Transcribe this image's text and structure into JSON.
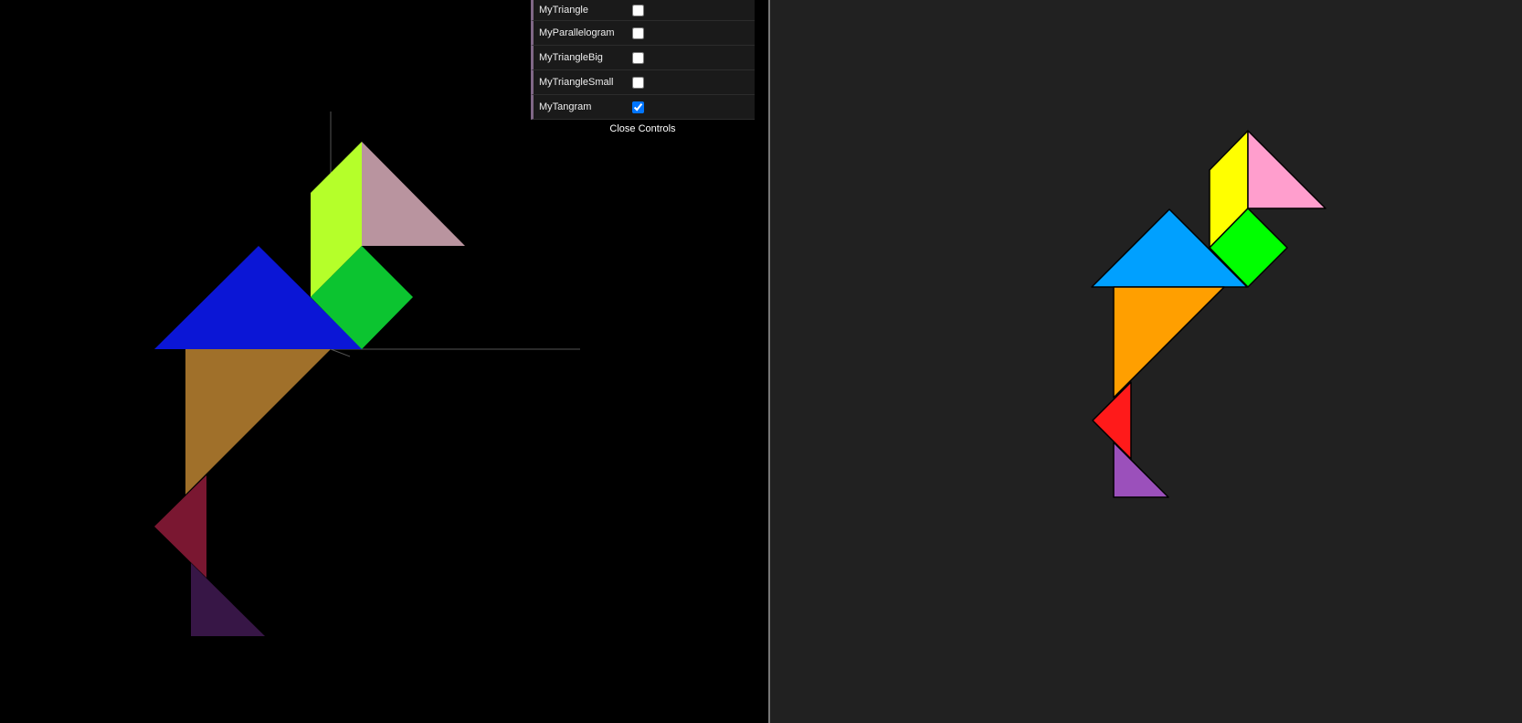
{
  "controls": {
    "items": [
      {
        "label": "MyTriangle",
        "checked": false
      },
      {
        "label": "MyParallelogram",
        "checked": false
      },
      {
        "label": "MyTriangleBig",
        "checked": false
      },
      {
        "label": "MyTriangleSmall",
        "checked": false
      },
      {
        "label": "MyTangram",
        "checked": true
      }
    ],
    "close_label": "Close Controls"
  },
  "scene": {
    "background": "#000000",
    "pieces": [
      {
        "name": "big-triangle-blue",
        "color": "#0b16d6"
      },
      {
        "name": "big-triangle-orange",
        "color": "#a0702a"
      },
      {
        "name": "parallelogram-yellow-green",
        "color": "#b5ff2a"
      },
      {
        "name": "medium-triangle-pink",
        "color": "#b9949f"
      },
      {
        "name": "square-green",
        "color": "#0cc430"
      },
      {
        "name": "small-triangle-red",
        "color": "#7a1731"
      },
      {
        "name": "small-triangle-purple",
        "color": "#371646"
      }
    ]
  },
  "reference": {
    "background": "#212121",
    "pieces": [
      {
        "name": "big-triangle-blue",
        "color": "#00a0ff"
      },
      {
        "name": "big-triangle-orange",
        "color": "#ff9f00"
      },
      {
        "name": "parallelogram-yellow",
        "color": "#ffff00"
      },
      {
        "name": "medium-triangle-pink",
        "color": "#ff9ecd"
      },
      {
        "name": "square-green",
        "color": "#00ff00"
      },
      {
        "name": "small-triangle-red",
        "color": "#ff1a1a"
      },
      {
        "name": "small-triangle-purple",
        "color": "#9b50bb"
      }
    ]
  }
}
